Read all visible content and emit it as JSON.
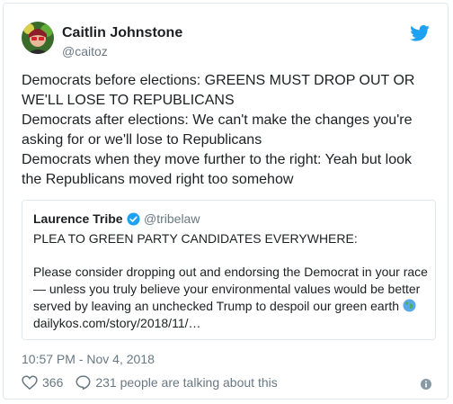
{
  "tweet": {
    "author_name": "Caitlin Johnstone",
    "author_handle": "@caitoz",
    "text": "Democrats before elections: GREENS MUST DROP OUT OR WE'LL LOSE TO REPUBLICANS\nDemocrats after elections: We can't make the changes you're asking for or we'll lose to Republicans\nDemocrats when they move further to the right: Yeah but look the Republicans moved right too somehow",
    "timestamp": "10:57 PM - Nov 4, 2018",
    "likes": "366",
    "talking": "231 people are talking about this"
  },
  "quoted": {
    "author_name": "Laurence Tribe",
    "author_handle": "@tribelaw",
    "line1": "PLEA TO GREEN PARTY CANDIDATES EVERYWHERE:",
    "body": "Please consider dropping out and endorsing the Democrat in your race — unless you truly believe your environmental values would be better served by leaving an unchecked Trump to despoil our green earth",
    "link": "dailykos.com/story/2018/11/…"
  },
  "colors": {
    "twitter_blue": "#1da1f2",
    "muted": "#697882",
    "border": "#e1e8ed"
  },
  "icons": [
    "twitter-bird-icon",
    "verified-badge-icon",
    "globe-icon",
    "heart-icon",
    "comment-icon",
    "info-icon"
  ]
}
